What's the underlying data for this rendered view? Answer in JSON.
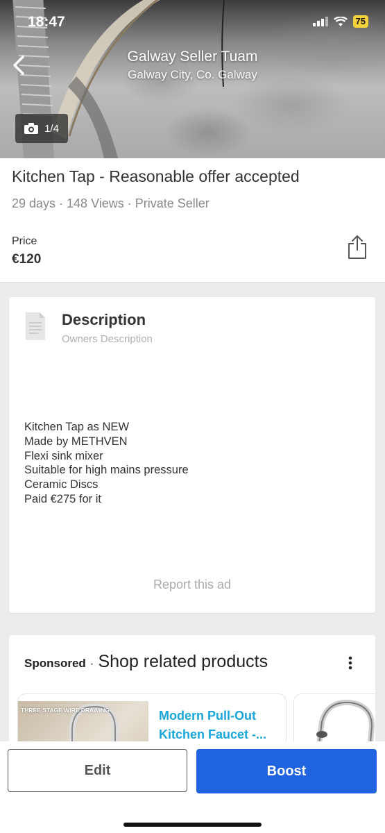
{
  "status_bar": {
    "time": "18:47",
    "battery": "75"
  },
  "header": {
    "seller_name": "Galway Seller Tuam",
    "seller_location": "Galway City, Co. Galway",
    "photo_counter": "1/4"
  },
  "listing": {
    "title": "Kitchen Tap - Reasonable offer accepted",
    "meta": "29 days · 148 Views · Private Seller",
    "price_label": "Price",
    "price_value": "€120"
  },
  "description": {
    "title": "Description",
    "subtitle": "Owners Description",
    "lines": [
      "Kitchen Tap as NEW",
      "Made by METHVEN",
      "Flexi sink mixer",
      "Suitable for high mains pressure",
      "Ceramic Discs",
      "Paid €275 for it"
    ],
    "report_link": "Report this ad"
  },
  "sponsored": {
    "label": "Sponsored",
    "separator": "·",
    "title": "Shop related products",
    "products": [
      {
        "image_caption": "THREE STAGE WIRE DRAWING",
        "name": "Modern Pull-Out Kitchen Faucet -..."
      },
      {
        "image_caption": "",
        "name": ""
      }
    ]
  },
  "actions": {
    "edit_label": "Edit",
    "boost_label": "Boost"
  },
  "colors": {
    "boost": "#1f63e0",
    "product_link": "#19a6d8",
    "battery": "#f3d23a"
  }
}
